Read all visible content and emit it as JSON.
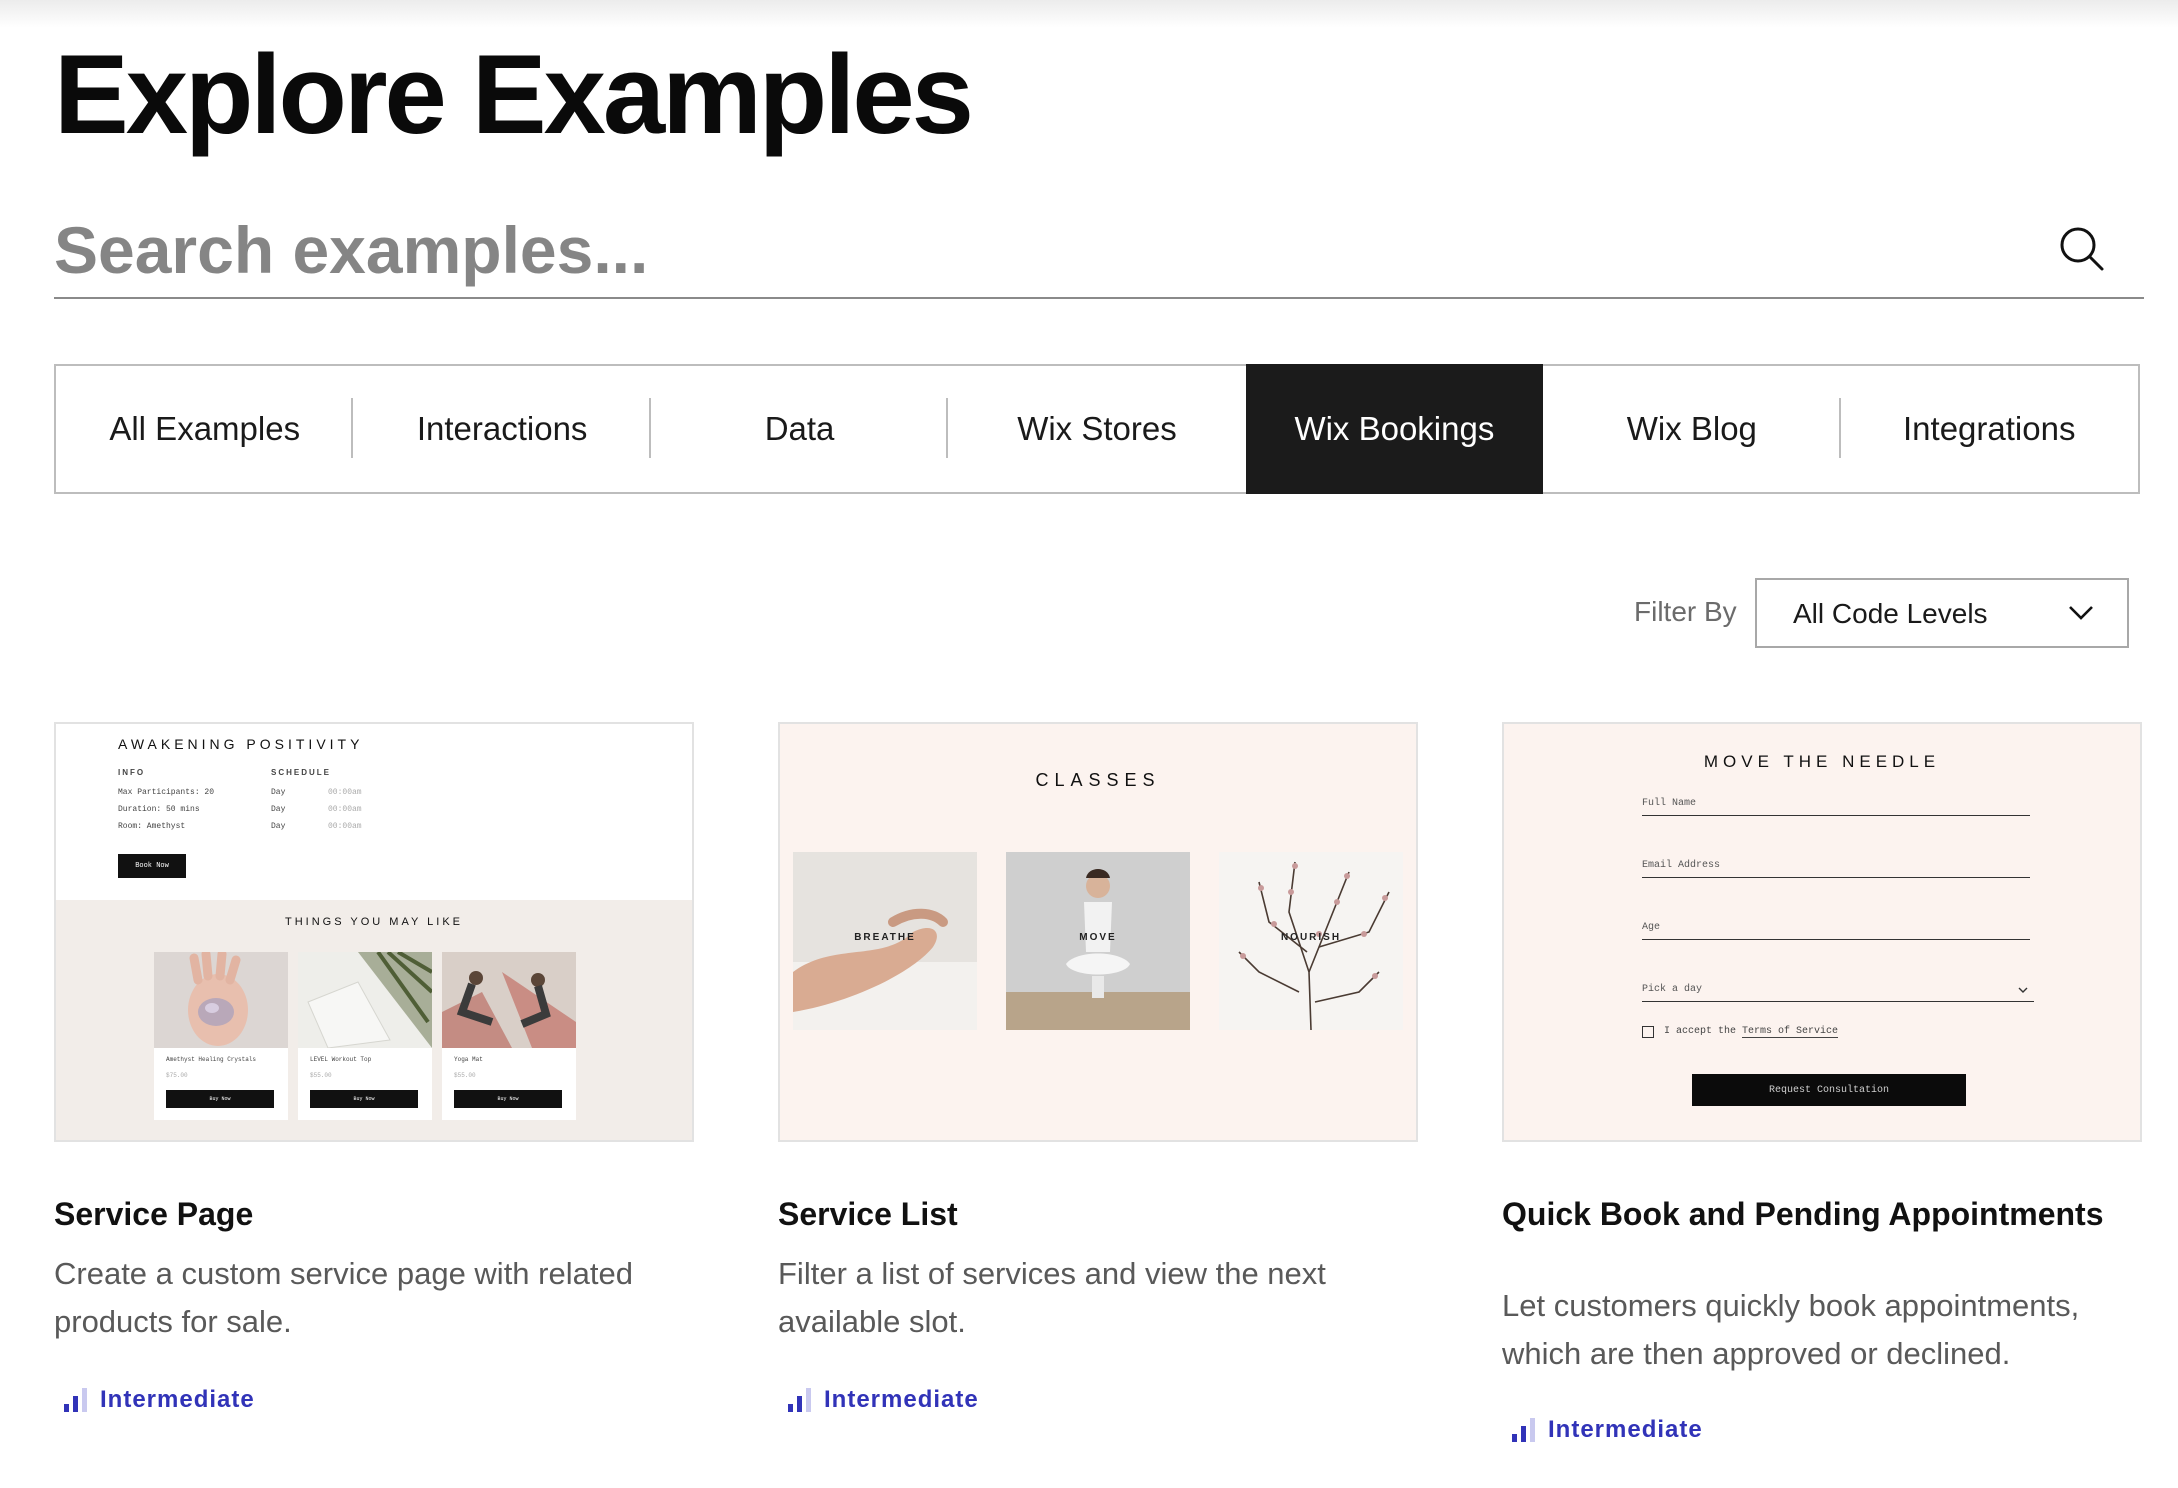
{
  "header": {
    "title": "Explore Examples"
  },
  "search": {
    "placeholder": "Search examples..."
  },
  "tabs": [
    {
      "label": "All Examples"
    },
    {
      "label": "Interactions"
    },
    {
      "label": "Data"
    },
    {
      "label": "Wix Stores"
    },
    {
      "label": "Wix Bookings",
      "active": true
    },
    {
      "label": "Wix Blog"
    },
    {
      "label": "Integrations"
    }
  ],
  "filter": {
    "label": "Filter By",
    "value": "All Code Levels"
  },
  "colors": {
    "accent": "#3133b8",
    "active_tab_bg": "#1b1b1b",
    "card_bg": "#fcf3ef"
  },
  "cards": [
    {
      "title": "Service Page",
      "description": "Create a custom service page with related products for sale.",
      "level": "Intermediate",
      "thumb": {
        "heading": "AWAKENING POSITIVITY",
        "info_label": "INFO",
        "schedule_label": "SCHEDULE",
        "info_rows": [
          "Max Participants: 20",
          "Duration: 50 mins",
          "Room: Amethyst"
        ],
        "schedule_rows": [
          "Day",
          "Day",
          "Day"
        ],
        "schedule_times": [
          "00:00am",
          "00:00am",
          "00:00am"
        ],
        "book_button": "Book Now",
        "related_heading": "THINGS YOU MAY LIKE",
        "products": [
          {
            "name": "Amethyst Healing Crystals",
            "price": "$75.00",
            "button": "Buy Now"
          },
          {
            "name": "LEVEL Workout Top",
            "price": "$55.00",
            "button": "Buy Now"
          },
          {
            "name": "Yoga Mat",
            "price": "$55.00",
            "button": "Buy Now"
          }
        ]
      }
    },
    {
      "title": "Service List",
      "description": "Filter a list of services and view the next available slot.",
      "level": "Intermediate",
      "thumb": {
        "heading": "CLASSES",
        "classes": [
          "BREATHE",
          "MOVE",
          "NOURISH"
        ]
      }
    },
    {
      "title": "Quick Book and Pending Appointments",
      "description": "Let customers quickly book appointments, which are then approved or declined.",
      "level": "Intermediate",
      "thumb": {
        "heading": "MOVE THE NEEDLE",
        "fields": [
          "Full Name",
          "Email Address",
          "Age"
        ],
        "select_placeholder": "Pick a day",
        "terms_prefix": "I accept the",
        "terms_link": "Terms of Service",
        "submit": "Request Consultation"
      }
    }
  ]
}
